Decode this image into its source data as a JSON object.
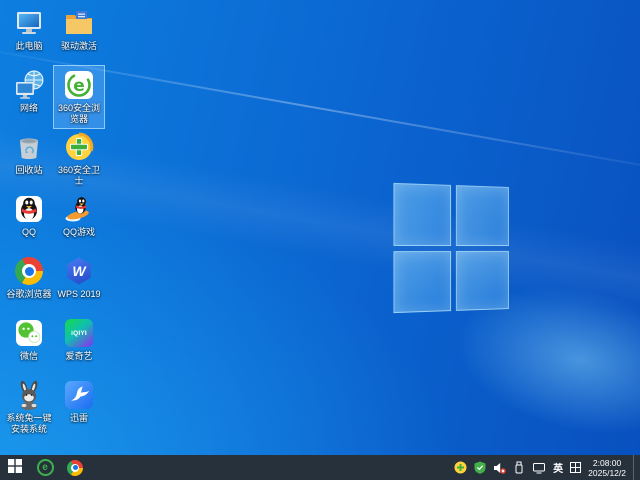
{
  "desktop": {
    "icons": [
      {
        "label": "此电脑"
      },
      {
        "label": "驱动激活"
      },
      {
        "label": "网络"
      },
      {
        "label": "360安全浏览器",
        "selected": true,
        "glyph": "e"
      },
      {
        "label": "回收站"
      },
      {
        "label": "360安全卫士"
      },
      {
        "label": "QQ"
      },
      {
        "label": "QQ游戏"
      },
      {
        "label": "谷歌浏览器"
      },
      {
        "label": "WPS 2019",
        "glyph": "W"
      },
      {
        "label": "微信"
      },
      {
        "label": "爱奇艺",
        "glyph": "iQIYI"
      },
      {
        "label": "系统兔一键安装系统"
      },
      {
        "label": "迅雷"
      }
    ]
  },
  "taskbar": {
    "ime_indicator": "英",
    "clock": {
      "time": "2:08:00",
      "date": "2025/12/2"
    }
  },
  "colors": {
    "taskbar_bg": "#26313c",
    "wallpaper_deep_blue": "#0850bf",
    "wallpaper_bright_blue": "#26b2fa",
    "selection_highlight": "#73b9fa"
  }
}
